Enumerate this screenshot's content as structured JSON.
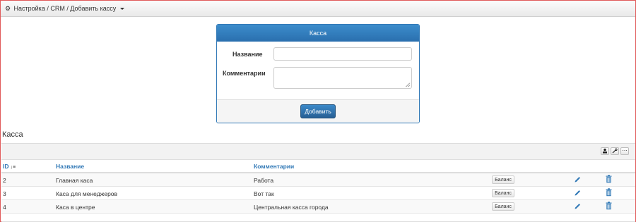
{
  "breadcrumb": {
    "items": [
      "Настройка",
      "CRM",
      "Добавить кассу"
    ],
    "separator": "/",
    "text": "Настройка / CRM / Добавить кассу"
  },
  "form": {
    "title": "Касса",
    "name_label": "Название",
    "name_value": "",
    "comment_label": "Комментарии",
    "comment_value": "",
    "submit_label": "Добавить"
  },
  "table": {
    "section_title": "Касса",
    "columns": {
      "id": "ID",
      "name": "Название",
      "comment": "Комментарии"
    },
    "rows": [
      {
        "id": "2",
        "name": "Главная каса",
        "comment": "Работа",
        "action": "Баланс"
      },
      {
        "id": "3",
        "name": "Каса для менеджеров",
        "comment": "Вот так",
        "action": "Баланс"
      },
      {
        "id": "4",
        "name": "Каса в центре",
        "comment": "Центральная касса города",
        "action": "Баланс"
      }
    ]
  },
  "colors": {
    "accent": "#337ab7",
    "window_border": "#e05a5a"
  }
}
